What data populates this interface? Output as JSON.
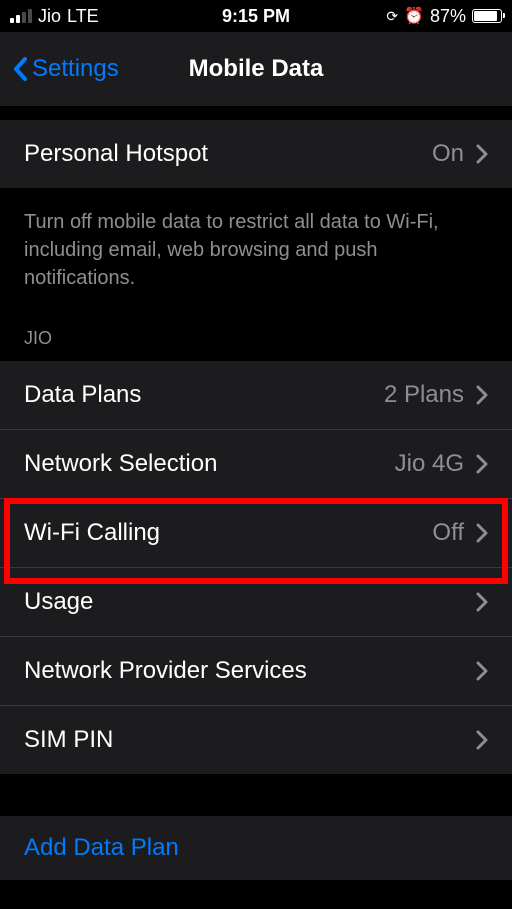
{
  "statusBar": {
    "carrier": "Jio",
    "network": "LTE",
    "time": "9:15 PM",
    "battery": "87%"
  },
  "nav": {
    "back": "Settings",
    "title": "Mobile Data"
  },
  "hotspot": {
    "label": "Personal Hotspot",
    "value": "On"
  },
  "description": "Turn off mobile data to restrict all data to Wi-Fi, including email, web browsing and push notifications.",
  "sectionHeader": "JIO",
  "rows": [
    {
      "label": "Data Plans",
      "value": "2 Plans"
    },
    {
      "label": "Network Selection",
      "value": "Jio 4G"
    },
    {
      "label": "Wi-Fi Calling",
      "value": "Off"
    },
    {
      "label": "Usage",
      "value": ""
    },
    {
      "label": "Network Provider Services",
      "value": ""
    },
    {
      "label": "SIM PIN",
      "value": ""
    }
  ],
  "addLink": "Add Data Plan"
}
